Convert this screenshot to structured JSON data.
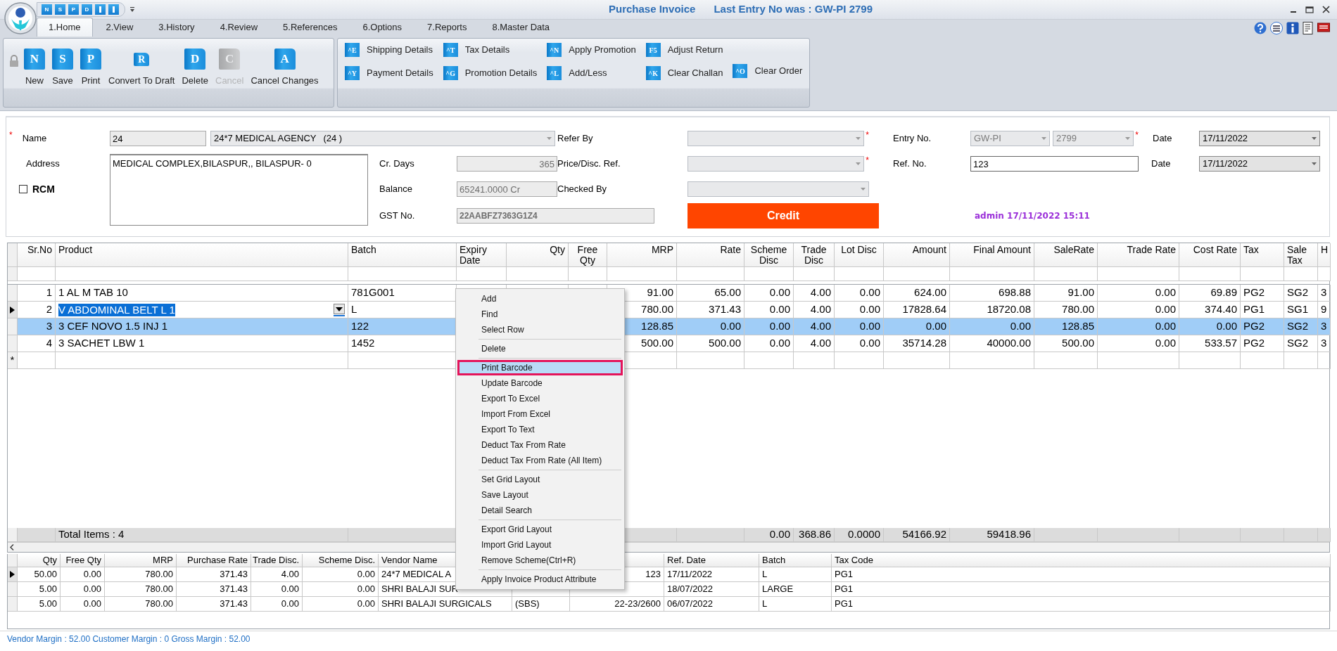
{
  "window": {
    "title": "Purchase Invoice",
    "subtitle": "Last Entry No was : GW-PI 2799"
  },
  "quick_access": [
    {
      "kind": "key",
      "key": "N"
    },
    {
      "kind": "key",
      "key": "S"
    },
    {
      "kind": "key",
      "key": "P"
    },
    {
      "kind": "key",
      "key": "D"
    },
    {
      "kind": "bar"
    },
    {
      "kind": "bar"
    }
  ],
  "tabs": [
    {
      "label": "1.Home",
      "selected": true
    },
    {
      "label": "2.View",
      "selected": false
    },
    {
      "label": "3.History",
      "selected": false
    },
    {
      "label": "4.Review",
      "selected": false
    },
    {
      "label": "5.References",
      "selected": false
    },
    {
      "label": "6.Options",
      "selected": false
    },
    {
      "label": "7.Reports",
      "selected": false
    },
    {
      "label": "8.Master Data",
      "selected": false
    }
  ],
  "ribbon": {
    "groups": [
      {
        "kind": "large",
        "buttons": [
          {
            "label": "New",
            "key": "N",
            "disabled": false
          },
          {
            "label": "Save",
            "key": "S",
            "disabled": false
          },
          {
            "label": "Print",
            "key": "P",
            "disabled": false
          },
          {
            "label": "Convert To Draft",
            "key": "R",
            "disabled": false
          },
          {
            "label": "Delete",
            "key": "D",
            "disabled": false
          },
          {
            "label": "Cancel",
            "key": "C",
            "disabled": true
          },
          {
            "label": "Cancel Changes",
            "key": "A",
            "disabled": false
          }
        ]
      },
      {
        "kind": "small",
        "columns": [
          [
            {
              "label": "Shipping Details",
              "key": "^E"
            },
            {
              "label": "Payment Details",
              "key": "^Y"
            }
          ],
          [
            {
              "label": "Tax Details",
              "key": "^T"
            },
            {
              "label": "Promotion Details",
              "key": "^G"
            }
          ],
          [
            {
              "label": "Apply Promotion",
              "key": "^N"
            },
            {
              "label": "Add/Less",
              "key": "^L"
            }
          ],
          [
            {
              "label": "Adjust Return",
              "key": "F5"
            },
            {
              "label": "Clear Challan",
              "key": "^K"
            }
          ],
          [
            {
              "label": "Clear Order",
              "key": "^O"
            }
          ]
        ]
      }
    ]
  },
  "form": {
    "name": {
      "label": "Name",
      "required": "*",
      "code": "24",
      "value": "24*7 MEDICAL AGENCY",
      "suffix": "(24 )"
    },
    "address": {
      "label": "Address",
      "value": "MEDICAL COMPLEX,BILASPUR,, BILASPUR- 0"
    },
    "rcm": {
      "label": "RCM",
      "checked": false
    },
    "cr_days": {
      "label": "Cr. Days",
      "value": "365"
    },
    "balance": {
      "label": "Balance",
      "value": "65241.0000 Cr"
    },
    "gst_no": {
      "label": "GST No.",
      "value": "22AABFZ7363G1Z4"
    },
    "refer_by": {
      "label": "Refer By",
      "required": "*"
    },
    "price_disc_ref": {
      "label": "Price/Disc. Ref.",
      "required": "*"
    },
    "checked_by": {
      "label": "Checked By"
    },
    "payment_button": "Credit",
    "entry_no": {
      "label": "Entry No.",
      "series": "GW-PI",
      "number": "2799",
      "required": "*"
    },
    "entry_date": {
      "label": "Date",
      "value": "17/11/2022"
    },
    "ref_no": {
      "label": "Ref. No.",
      "value": "123"
    },
    "ref_date": {
      "label": "Date",
      "value": "17/11/2022"
    },
    "audit": "admin 17/11/2022 15:11"
  },
  "grid": {
    "columns": [
      "Sr.No",
      "Product",
      "Batch",
      "Expiry Date",
      "Qty",
      "Free Qty",
      "MRP",
      "Rate",
      "Scheme Disc",
      "Trade Disc",
      "Lot Disc",
      "Amount",
      "Final Amount",
      "SaleRate",
      "Trade Rate",
      "Cost Rate",
      "Tax",
      "Sale Tax",
      "H"
    ],
    "rows": [
      {
        "current": false,
        "selected": false,
        "sr_no": "1",
        "product": "1 AL M TAB 10",
        "batch": "781G001",
        "mrp": "91.00",
        "rate": "65.00",
        "scheme_disc": "0.00",
        "trade_disc": "4.00",
        "lot_disc": "0.00",
        "amount": "624.00",
        "final_amount": "698.88",
        "sale_rate": "91.00",
        "trade_rate": "0.00",
        "cost_rate": "69.89",
        "tax": "PG2",
        "sale_tax": "SG2",
        "h": "3"
      },
      {
        "current": true,
        "selected": false,
        "sr_no": "2",
        "product": "V ABDOMINAL BELT L 1",
        "batch": "L",
        "mrp": "780.00",
        "rate": "371.43",
        "scheme_disc": "0.00",
        "trade_disc": "4.00",
        "lot_disc": "0.00",
        "amount": "17828.64",
        "final_amount": "18720.08",
        "sale_rate": "780.00",
        "trade_rate": "0.00",
        "cost_rate": "374.40",
        "tax": "PG1",
        "sale_tax": "SG1",
        "h": "9"
      },
      {
        "current": false,
        "selected": true,
        "sr_no": "3",
        "product": "3 CEF NOVO 1.5 INJ 1",
        "batch": "122",
        "mrp": "128.85",
        "rate": "0.00",
        "scheme_disc": "0.00",
        "trade_disc": "4.00",
        "lot_disc": "0.00",
        "amount": "0.00",
        "final_amount": "0.00",
        "sale_rate": "128.85",
        "trade_rate": "0.00",
        "cost_rate": "0.00",
        "tax": "PG2",
        "sale_tax": "SG2",
        "h": "3"
      },
      {
        "current": false,
        "selected": false,
        "sr_no": "4",
        "product": "3 SACHET LBW 1",
        "batch": "1452",
        "mrp": "500.00",
        "rate": "500.00",
        "scheme_disc": "0.00",
        "trade_disc": "4.00",
        "lot_disc": "0.00",
        "amount": "35714.28",
        "final_amount": "40000.00",
        "sale_rate": "500.00",
        "trade_rate": "0.00",
        "cost_rate": "533.57",
        "tax": "PG2",
        "sale_tax": "SG2",
        "h": "3"
      }
    ],
    "new_row_marker": "*",
    "totals": {
      "label": "Total Items : 4",
      "scheme_disc": "0.00",
      "trade_disc": "368.86",
      "lot_disc": "0.0000",
      "amount": "54166.92",
      "final_amount": "59418.96"
    }
  },
  "history": {
    "headers": {
      "qty": "Qty",
      "free_qty": "Free Qty",
      "mrp": "MRP",
      "purchase_rate": "Purchase Rate",
      "trade_disc": "Trade Disc.",
      "scheme_disc": "Scheme Disc.",
      "vendor_name": "Vendor Name",
      "ref_date": "Ref. Date",
      "batch": "Batch",
      "tax_code": "Tax Code"
    },
    "rows": [
      {
        "current": true,
        "qty": "50.00",
        "free_qty": "0.00",
        "mrp": "780.00",
        "purchase_rate": "371.43",
        "trade_disc": "4.00",
        "scheme_disc": "0.00",
        "vendor_name": "24*7 MEDICAL A",
        "column_9": "123",
        "ref_date": "17/11/2022",
        "batch": "L",
        "tax_code": "PG1"
      },
      {
        "current": false,
        "qty": "5.00",
        "free_qty": "0.00",
        "mrp": "780.00",
        "purchase_rate": "371.43",
        "trade_disc": "0.00",
        "scheme_disc": "0.00",
        "vendor_name": "SHRI BALAJI SUR",
        "ref_date": "18/07/2022",
        "batch": "LARGE",
        "tax_code": "PG1"
      },
      {
        "current": false,
        "qty": "5.00",
        "free_qty": "0.00",
        "mrp": "780.00",
        "purchase_rate": "371.43",
        "trade_disc": "0.00",
        "scheme_disc": "0.00",
        "vendor_name": "SHRI BALAJI SURGICALS",
        "column_8": "(SBS)",
        "column_9": "22-23/2600",
        "ref_date": "06/07/2022",
        "batch": "L",
        "tax_code": "PG1"
      }
    ]
  },
  "context_menu": {
    "groups": [
      [
        {
          "label": "Add",
          "selected": false
        },
        {
          "label": "Find",
          "selected": false
        },
        {
          "label": "Select Row",
          "selected": false
        }
      ],
      [
        {
          "label": "Delete",
          "selected": false
        }
      ],
      [
        {
          "label": "Print Barcode",
          "selected": true
        },
        {
          "label": "Update Barcode",
          "selected": false
        },
        {
          "label": "Export To Excel",
          "selected": false
        },
        {
          "label": "Import From Excel",
          "selected": false
        },
        {
          "label": "Export To Text",
          "selected": false
        },
        {
          "label": "Deduct Tax From Rate",
          "selected": false
        },
        {
          "label": "Deduct Tax From Rate (All Item)",
          "selected": false
        }
      ],
      [
        {
          "label": "Set Grid Layout",
          "selected": false
        },
        {
          "label": "Save Layout",
          "selected": false
        },
        {
          "label": "Detail Search",
          "selected": false
        }
      ],
      [
        {
          "label": "Export Grid Layout",
          "selected": false
        },
        {
          "label": "Import Grid Layout",
          "selected": false
        },
        {
          "label": "Remove Scheme(Ctrl+R)",
          "selected": false
        }
      ],
      [
        {
          "label": "Apply Invoice Product Attribute",
          "selected": false
        }
      ]
    ]
  },
  "status_bar": "Vendor Margin : 52.00 Customer Margin : 0 Gross Margin : 52.00"
}
